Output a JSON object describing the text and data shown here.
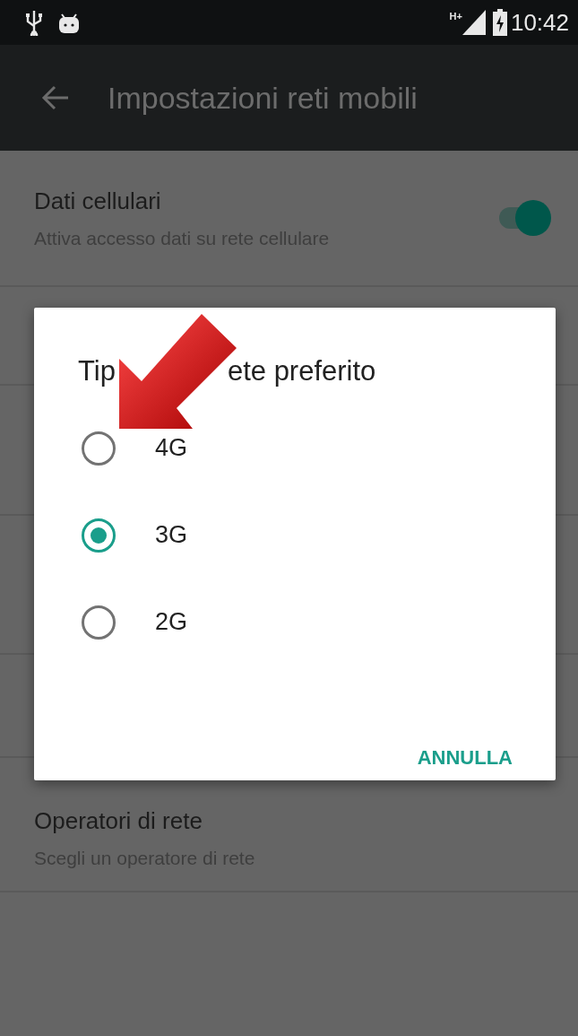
{
  "status_bar": {
    "network_type": "H+",
    "time": "10:42"
  },
  "toolbar": {
    "title": "Impostazioni reti mobili"
  },
  "settings": [
    {
      "kind": "switch",
      "title": "Dati cellulari",
      "subtitle": "Attiva accesso dati su rete cellulare",
      "on": true
    },
    {
      "kind": "plain",
      "title": "Operatori di rete",
      "subtitle": "Scegli un operatore di rete"
    }
  ],
  "dialog": {
    "title_parts": [
      "Tip",
      "ete preferito"
    ],
    "options": [
      {
        "label": "4G",
        "selected": false
      },
      {
        "label": "3G",
        "selected": true
      },
      {
        "label": "2G",
        "selected": false
      }
    ],
    "buttons": [
      "ANNULLA"
    ]
  }
}
